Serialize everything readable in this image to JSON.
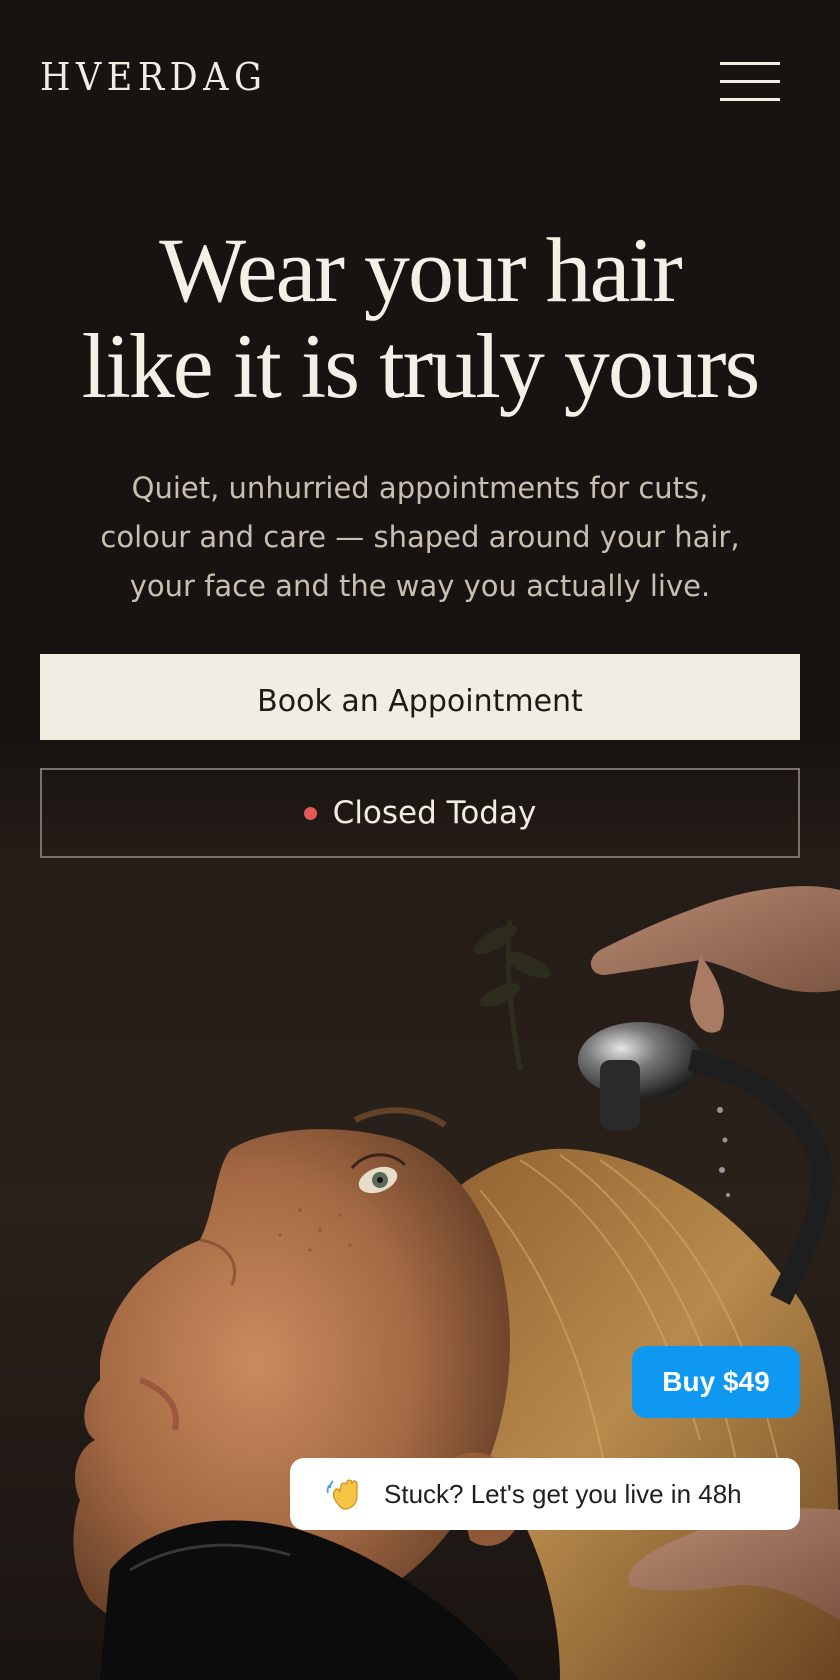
{
  "header": {
    "logo_text": "HVERDAG",
    "menu_icon": "hamburger-menu-icon"
  },
  "hero": {
    "headline_line1": "Wear your hair",
    "headline_line2": "like it is truly yours",
    "subtitle_line1": "Quiet, unhurried appointments for cuts,",
    "subtitle_line2": "colour and care — shaped around your hair,",
    "subtitle_line3": "your face and the way you actually live.",
    "book_button_label": "Book an Appointment",
    "status_label": "Closed Today",
    "status_color": "#e25b58",
    "image_icon": "salon-hair-wash-photo"
  },
  "widgets": {
    "buy_button_label": "Buy $49",
    "buy_button_color": "#0f98f2",
    "chat_icon": "waving-hand-icon",
    "chat_text": "Stuck? Let's get you live in 48h"
  },
  "colors": {
    "background": "#171311",
    "cream": "#f2ede2",
    "text_light": "#f4f0e6",
    "text_muted": "#c9bfb1"
  }
}
